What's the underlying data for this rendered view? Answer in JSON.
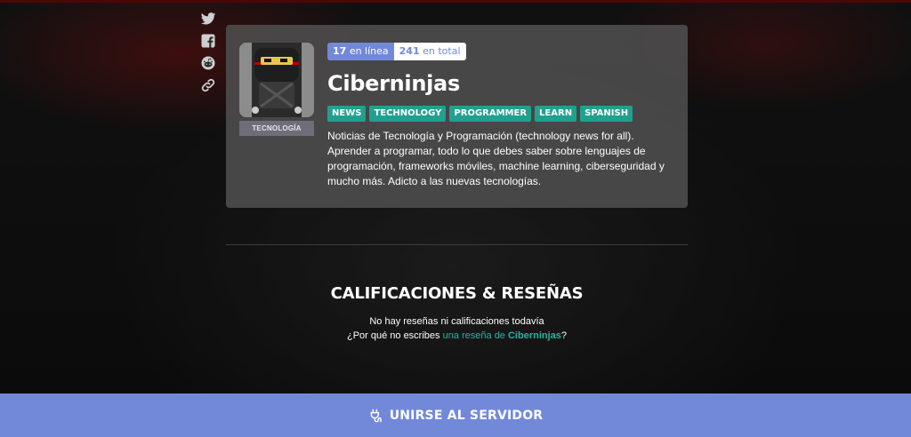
{
  "server": {
    "name": "Ciberninjas",
    "category": "TECNOLOGÍA",
    "online_count": "17",
    "online_label": "en línea",
    "total_count": "241",
    "total_label": "en total",
    "tags": [
      "NEWS",
      "TECHNOLOGY",
      "PROGRAMMER",
      "LEARN",
      "SPANISH"
    ],
    "description": "Noticias de Tecnología y Programación (technology news for all). Aprender a programar, todo lo que debes saber sobre lenguajes de programación, frameworks móviles, machine learning, ciberseguridad y mucho más. Adicto a las nuevas tecnologías."
  },
  "social": {
    "icons": [
      "twitter-icon",
      "facebook-icon",
      "reddit-icon",
      "link-icon"
    ]
  },
  "reviews": {
    "heading": "CALIFICACIONES & RESEÑAS",
    "empty_text": "No hay reseñas ni calificaciones todavía",
    "prompt_prefix": "¿Por qué no escribes ",
    "prompt_link": "una reseña de ",
    "prompt_link_name": "Ciberninjas",
    "prompt_suffix": "?"
  },
  "join": {
    "label": "UNIRSE AL SERVIDOR",
    "icon": "plug-icon"
  },
  "colors": {
    "accent": "#7289da",
    "tag": "#22a08f",
    "link": "#2ab3a0",
    "card": "#4e4e4e"
  }
}
